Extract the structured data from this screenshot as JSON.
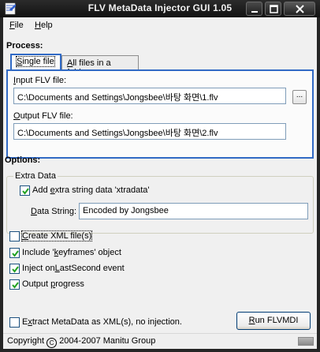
{
  "window": {
    "title": "FLV MetaData Injector GUI 1.05",
    "controls": {
      "minimize": "minimize",
      "maximize": "maximize",
      "close": "close"
    }
  },
  "menu": {
    "file": {
      "accel": "F",
      "rest": "ile"
    },
    "help": {
      "accel": "H",
      "rest": "elp"
    }
  },
  "process": {
    "heading": "Process:",
    "tabs": [
      {
        "label": "Single file",
        "accel": "S",
        "rest": "ingle file",
        "active": true
      },
      {
        "label": "All files in a folder",
        "accel": "A",
        "rest": "ll files in a folder",
        "active": false
      }
    ],
    "input": {
      "label_accel": "I",
      "label_rest": "nput FLV file:",
      "value": "C:\\Documents and Settings\\Jongsbee\\바탕 화면\\1.flv",
      "browse_label": "..."
    },
    "output": {
      "label_accel": "O",
      "label_rest": "utput FLV file:",
      "value": "C:\\Documents and Settings\\Jongsbee\\바탕 화면\\2.flv"
    }
  },
  "options": {
    "heading": "Options:",
    "extra_data": {
      "group_title": "Extra Data",
      "add_extra": {
        "pre": "Add ",
        "accel": "e",
        "rest": "xtra string data 'xtradata'",
        "checked": true
      },
      "data_string": {
        "accel": "D",
        "rest": "ata String:",
        "value": "Encoded by Jongsbee"
      }
    },
    "checkboxes": [
      {
        "pre": "",
        "accel": "C",
        "rest": "reate XML file(s)",
        "checked": false
      },
      {
        "pre": "Include '",
        "accel": "k",
        "rest": "eyframes' object",
        "checked": true
      },
      {
        "pre": "Inject on",
        "accel": "L",
        "rest": "astSecond event",
        "checked": true
      },
      {
        "pre": "Output ",
        "accel": "p",
        "rest": "rogress",
        "checked": true
      }
    ],
    "extract": {
      "pre": "E",
      "accel": "x",
      "rest": "tract MetaData as XML(s), no injection.",
      "checked": false
    },
    "run": {
      "accel": "R",
      "rest": "un FLVMDI"
    }
  },
  "status": {
    "copyright_pre": "Copyright",
    "copy_symbol": "C",
    "copyright_post": "2004-2007 Manitu Group"
  },
  "colors": {
    "accent": "#316ac5",
    "check": "#21a121",
    "titlebar": "#1a1a1a"
  }
}
